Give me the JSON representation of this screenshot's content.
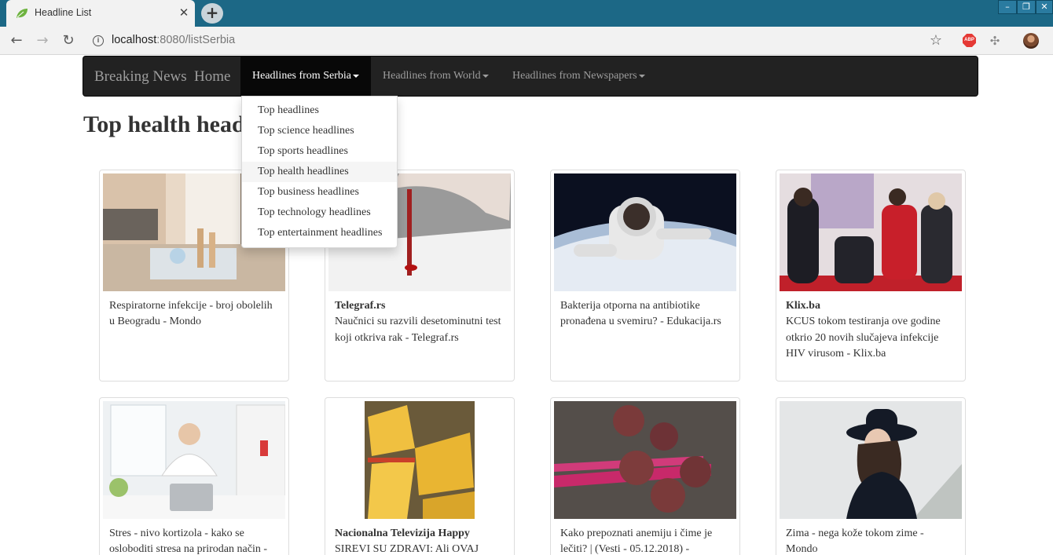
{
  "browser": {
    "tab_title": "Headline List",
    "tab_close": "✕",
    "new_tab": "+",
    "url_host": "localhost",
    "url_path": ":8080/listSerbia",
    "abp_label": "ABP"
  },
  "navbar": {
    "brand": "Breaking News",
    "home": "Home",
    "items": [
      {
        "label": "Headlines from Serbia",
        "active": true
      },
      {
        "label": "Headlines from World"
      },
      {
        "label": "Headlines from Newspapers"
      }
    ]
  },
  "dropdown": {
    "items": [
      {
        "label": "Top headlines"
      },
      {
        "label": "Top science headlines"
      },
      {
        "label": "Top sports headlines"
      },
      {
        "label": "Top health headlines",
        "hovered": true
      },
      {
        "label": "Top business headlines"
      },
      {
        "label": "Top technology headlines"
      },
      {
        "label": "Top entertainment headlines"
      }
    ]
  },
  "page": {
    "title": "Top health headlines"
  },
  "cards": [
    {
      "source": "",
      "text": "Respiratorne infekcije - broj obolelih u Beogradu - Mondo"
    },
    {
      "source": "Telegraf.rs",
      "text": "Naučnici su razvili desetominutni test koji otkriva rak - Telegraf.rs"
    },
    {
      "source": "",
      "text": "Bakterija otporna na antibiotike pronađena u svemiru? - Edukacija.rs"
    },
    {
      "source": "Klix.ba",
      "text": "KCUS tokom testiranja ove godine otkrio 20 novih slučajeva infekcije HIV virusom - Klix.ba"
    },
    {
      "source": "",
      "text": "Stres - nivo kortizola - kako se osloboditi stresa na prirodan način -"
    },
    {
      "source": "Nacionalna Televizija Happy",
      "text": "SIREVI SU ZDRAVI: Ali OVAJ"
    },
    {
      "source": "",
      "text": "Kako prepoznati anemiju i čime je lečiti? | (Vesti - 05.12.2018) -"
    },
    {
      "source": "",
      "text": "Zima - nega kože tokom zime - Mondo"
    }
  ]
}
